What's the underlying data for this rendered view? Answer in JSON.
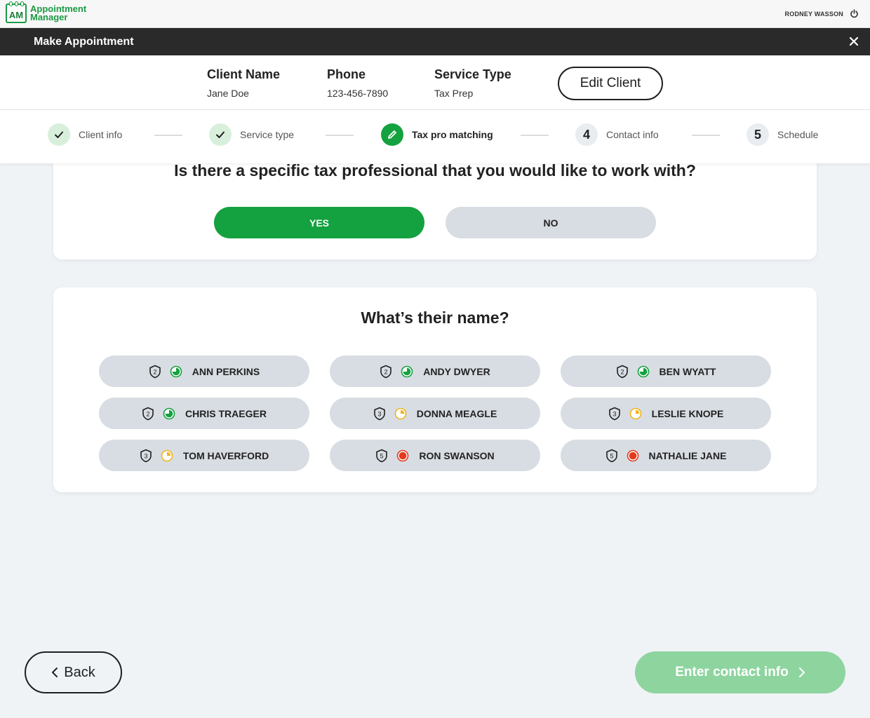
{
  "app": {
    "logo_badge": "AM",
    "logo_line1": "Appointment",
    "logo_line2": "Manager",
    "brand_color": "#14a13f"
  },
  "user": {
    "name": "RODNEY WASSON"
  },
  "titlebar": {
    "title": "Make Appointment"
  },
  "client": {
    "name_label": "Client Name",
    "name_value": "Jane Doe",
    "phone_label": "Phone",
    "phone_value": "123-456-7890",
    "service_label": "Service Type",
    "service_value": "Tax Prep",
    "edit_label": "Edit Client"
  },
  "steps": [
    {
      "label": "Client info",
      "state": "done"
    },
    {
      "label": "Service type",
      "state": "done"
    },
    {
      "label": "Tax pro matching",
      "state": "active"
    },
    {
      "label": "Contact info",
      "state": "todo",
      "number": "4"
    },
    {
      "label": "Schedule",
      "state": "todo",
      "number": "5"
    }
  ],
  "question1": {
    "text": "Is there a specific tax professional that you would like to work with?",
    "yes": "YES",
    "no": "NO",
    "selected": "yes"
  },
  "question2": {
    "text": "What’s their name?"
  },
  "pros": [
    {
      "name": "ANN PERKINS",
      "level": "2",
      "availability": 0.75,
      "availability_color": "#14a13f"
    },
    {
      "name": "ANDY DWYER",
      "level": "2",
      "availability": 0.75,
      "availability_color": "#14a13f"
    },
    {
      "name": "BEN WYATT",
      "level": "2",
      "availability": 0.75,
      "availability_color": "#14a13f"
    },
    {
      "name": "CHRIS TRAEGER",
      "level": "2",
      "availability": 0.75,
      "availability_color": "#14a13f"
    },
    {
      "name": "DONNA MEAGLE",
      "level": "3",
      "availability": 0.25,
      "availability_color": "#f1b51c"
    },
    {
      "name": "LESLIE KNOPE",
      "level": "3",
      "availability": 0.25,
      "availability_color": "#f1b51c"
    },
    {
      "name": "TOM HAVERFORD",
      "level": "3",
      "availability": 0.25,
      "availability_color": "#f1b51c"
    },
    {
      "name": "RON SWANSON",
      "level": "5",
      "availability": 1.0,
      "availability_color": "#e53a1d"
    },
    {
      "name": "NATHALIE JANE",
      "level": "5",
      "availability": 1.0,
      "availability_color": "#e53a1d"
    }
  ],
  "nav": {
    "back": "Back",
    "next": "Enter contact info"
  }
}
